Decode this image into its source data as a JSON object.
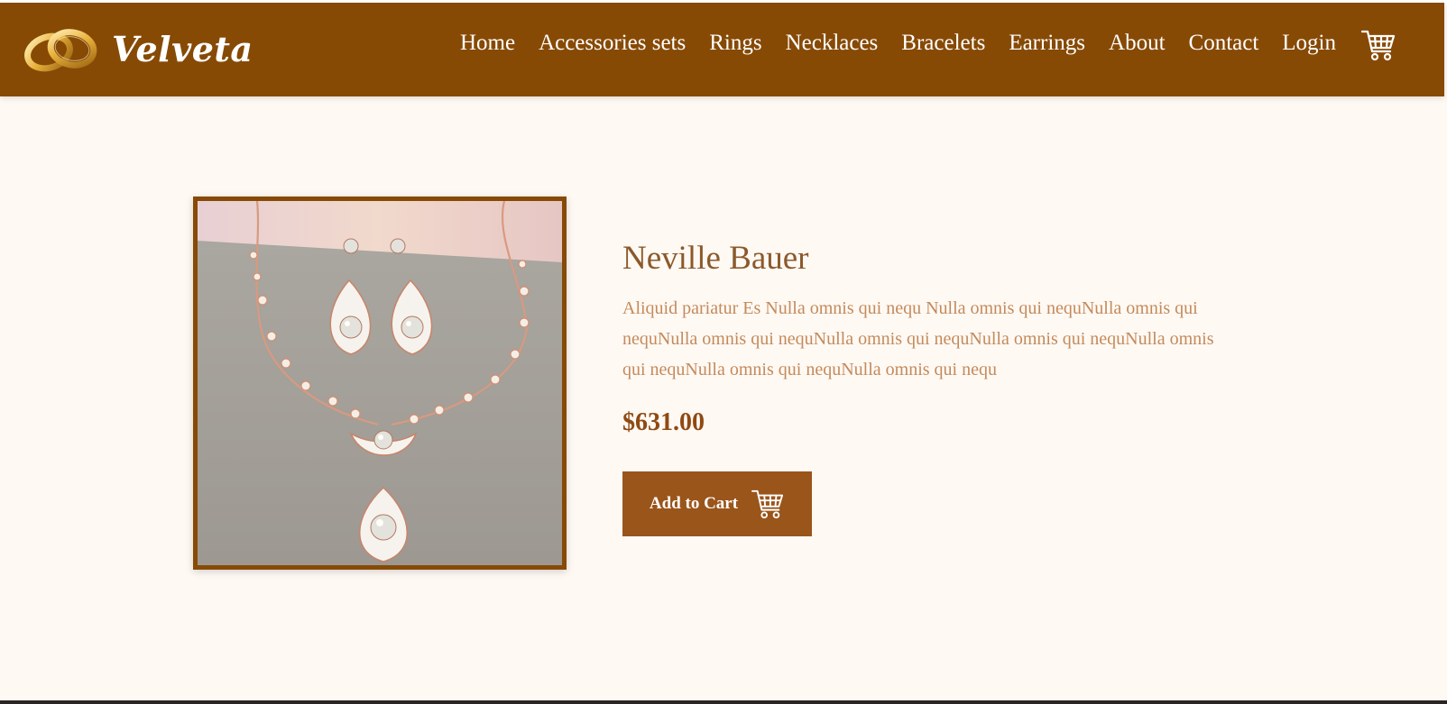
{
  "brand": {
    "name": "Velveta",
    "logo_icon": "wedding-rings-icon"
  },
  "nav": {
    "items": [
      "Home",
      "Accessories sets",
      "Rings",
      "Necklaces",
      "Bracelets",
      "Earrings",
      "About",
      "Contact",
      "Login"
    ],
    "cart_icon": "shopping-cart-icon"
  },
  "product": {
    "title": "Neville Bauer",
    "description": "Aliquid pariatur Es Nulla omnis qui nequ Nulla omnis qui nequNulla omnis qui nequNulla omnis qui nequNulla omnis qui nequNulla omnis qui nequNulla omnis qui nequNulla omnis qui nequNulla omnis qui nequ",
    "price": "$631.00",
    "image_icon": "necklace-earrings-photo",
    "add_to_cart_label": "Add to Cart",
    "add_to_cart_icon": "shopping-cart-icon"
  },
  "colors": {
    "header_bg": "#874a05",
    "page_bg": "#fff9f4",
    "title": "#8b5a2b",
    "description": "#c48a5a",
    "price": "#8f4a12",
    "button_bg": "#9a551b"
  }
}
